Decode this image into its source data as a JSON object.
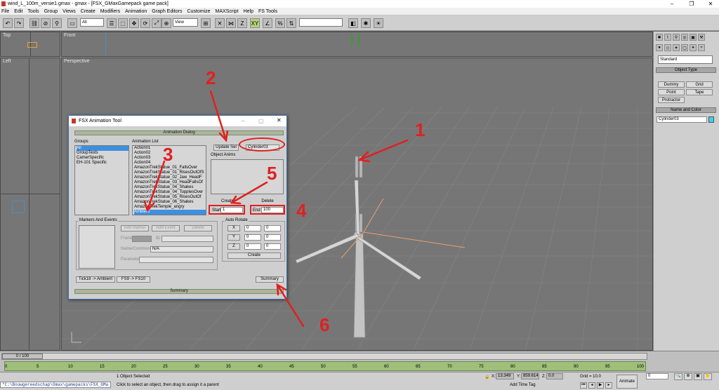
{
  "window": {
    "title": "wind_L_100m_versie1.gmax - gmax - [FSX_GMaxGamepack game pack]",
    "controls": [
      "–",
      "❐",
      "✕"
    ]
  },
  "menu": [
    "File",
    "Edit",
    "Tools",
    "Group",
    "Views",
    "Create",
    "Modifiers",
    "Animation",
    "Graph Editors",
    "Customize",
    "MAXScript",
    "Help",
    "FS Tools"
  ],
  "toolbar": {
    "filter_select": "All",
    "coord_select": "View",
    "icons": [
      "undo-icon",
      "redo-icon",
      "link-icon",
      "unlink-icon",
      "bind-icon",
      "select-icon",
      "select-by-name-icon",
      "select-region-icon",
      "move-icon",
      "rotate-icon",
      "scale-icon",
      "pivot-icon",
      "mirror-icon",
      "align-icon",
      "snap-icon",
      "angle-snap-icon",
      "percent-snap-icon",
      "named-sel-icon",
      "bug-icon",
      "render-icon"
    ]
  },
  "viewports": {
    "top_label": "Top",
    "front_label": "Front",
    "left_label": "Left",
    "perspective_label": "Perspective"
  },
  "command_panel": {
    "category": "Standard",
    "object_type_title": "Object Type",
    "object_buttons": [
      "Dummy",
      "Grid",
      "Point",
      "Tape",
      "Protractor"
    ],
    "name_color_title": "Name and Color",
    "object_name": "Cylinder03",
    "swatch_color": "#3fd0e8"
  },
  "dialog": {
    "title": "FSX Animation Tool",
    "section_title": "Animation Dialog",
    "groups_label": "Groups",
    "groups": [
      "All",
      "GroupTests",
      "CamerSpecific",
      "EH-101 Specific"
    ],
    "groups_selected": 0,
    "animlist_label": "Animation List",
    "animations": [
      "Action01",
      "Action02",
      "Action03",
      "Action04",
      "AmazonTrekStatue_01_FallsOver",
      "AmazonTrekStatue_01_RisesOutOfS",
      "AmazonTrekStatue_02_Jaw_HeadF",
      "AmazonTrekStatue_03_HeadFallsOf",
      "AmazonTrekStatue_04_Shakes",
      "AmazonTrekStatue_04_TopplesOver",
      "AmazonTrekStatue_05_RisesOutOf",
      "AmazonTrekStatue_06_Shakes",
      "AmazonTrekTemple_angry",
      "Ambient"
    ],
    "animations_selected": 13,
    "update_sel": "Update Sel",
    "selected_object": "Cylinder03",
    "object_anims_label": "Object Anims",
    "create_label": "Create",
    "delete_label": "Delete",
    "start_label": "Start",
    "start_value": "1",
    "end_label": "End",
    "end_value": "100",
    "markers_label": "Markers And Events",
    "add_marker": "Add Marker",
    "add_event": "Add Event",
    "delete_btn": "Delete",
    "frame_label": "Frame",
    "id_label": "ID",
    "name_comment_label": "Name/Comment",
    "name_comment_value": "N/A",
    "parameter_label": "Parameter",
    "auto_rotate_label": "Auto Rotate",
    "axes": [
      "X",
      "Y",
      "Z"
    ],
    "axis_values": [
      [
        "0",
        "0"
      ],
      [
        "0",
        "0"
      ],
      [
        "0",
        "0"
      ]
    ],
    "rotate_create": "Create",
    "tick18_btn": "Tick18 -> Ambient",
    "fs9_btn": "FS9 -> FS10",
    "summary_btn": "Summary",
    "summary_bar": "Summary"
  },
  "annotations": [
    "1",
    "2",
    "3",
    "4",
    "5",
    "6"
  ],
  "annotation_color": "#e02020",
  "timeline": {
    "frame_counter": "0 / 100",
    "ticks": [
      "0",
      "5",
      "10",
      "15",
      "20",
      "25",
      "30",
      "35",
      "40",
      "45",
      "50",
      "55",
      "60",
      "65",
      "70",
      "75",
      "80",
      "85",
      "90",
      "95",
      "100"
    ]
  },
  "status": {
    "script_path": "\"C:\\Bouwgereedschap\\Gmax\\gamepacks\\FSX_GMa",
    "selection": "1 Object Selected",
    "prompt": "Click to select an object, then drag to assign it a parent",
    "x_label": "X:",
    "x_value": "13.349",
    "y_label": "Y:",
    "y_value": "859.614",
    "z_label": "Z:",
    "z_value": "0.0",
    "grid": "Grid = 10.0",
    "add_time_tag": "Add Time Tag",
    "animate": "Animate",
    "frame_value": "0"
  }
}
